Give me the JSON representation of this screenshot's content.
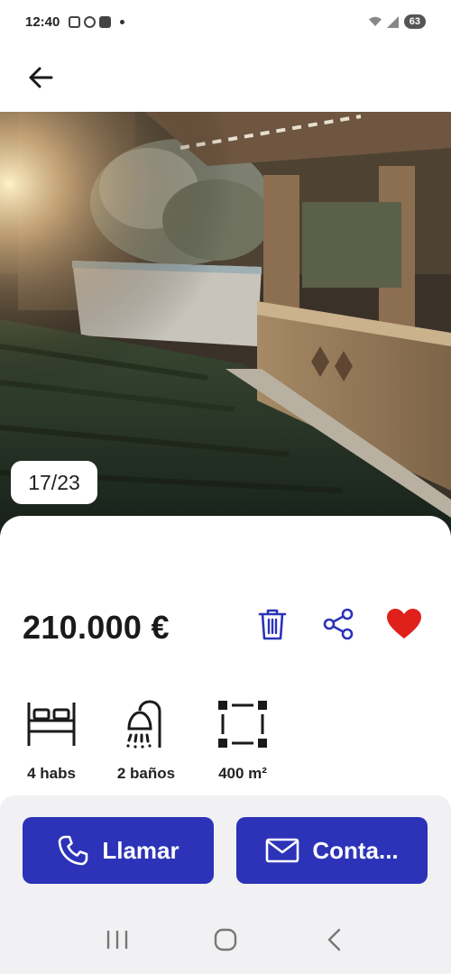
{
  "status_bar": {
    "time": "12:40",
    "battery": "63"
  },
  "photo": {
    "counter": "17/23"
  },
  "listing": {
    "price": "210.000 €",
    "features": [
      {
        "icon": "bed-icon",
        "label": "4 habs"
      },
      {
        "icon": "shower-icon",
        "label": "2 baños"
      },
      {
        "icon": "area-icon",
        "label": "400 m²"
      }
    ]
  },
  "actions": {
    "call_label": "Llamar",
    "contact_label": "Conta..."
  },
  "colors": {
    "primary": "#2c33b8",
    "icon_blue": "#2c33b8",
    "favorite": "#e0201b"
  }
}
